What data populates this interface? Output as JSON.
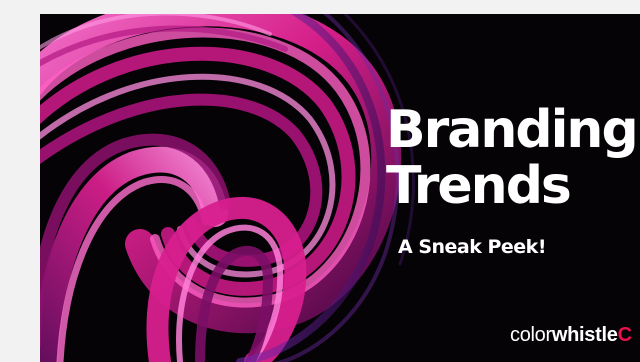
{
  "banner": {
    "title_line1": "Branding",
    "title_line2": "Trends",
    "subtitle": "A Sneak Peek!",
    "logo_part1": "color",
    "logo_part2": "whistle",
    "logo_mark": "C"
  },
  "colors": {
    "page_background": "#f2f2f2",
    "banner_background": "#050306",
    "swirl_primary": "#e0208f",
    "swirl_highlight": "#ff6fd0",
    "swirl_dark": "#5a0a55",
    "text": "#ffffff",
    "logo_accent": "#e8114a"
  },
  "icons": {
    "background_art": "pink-swirl-graphic"
  }
}
